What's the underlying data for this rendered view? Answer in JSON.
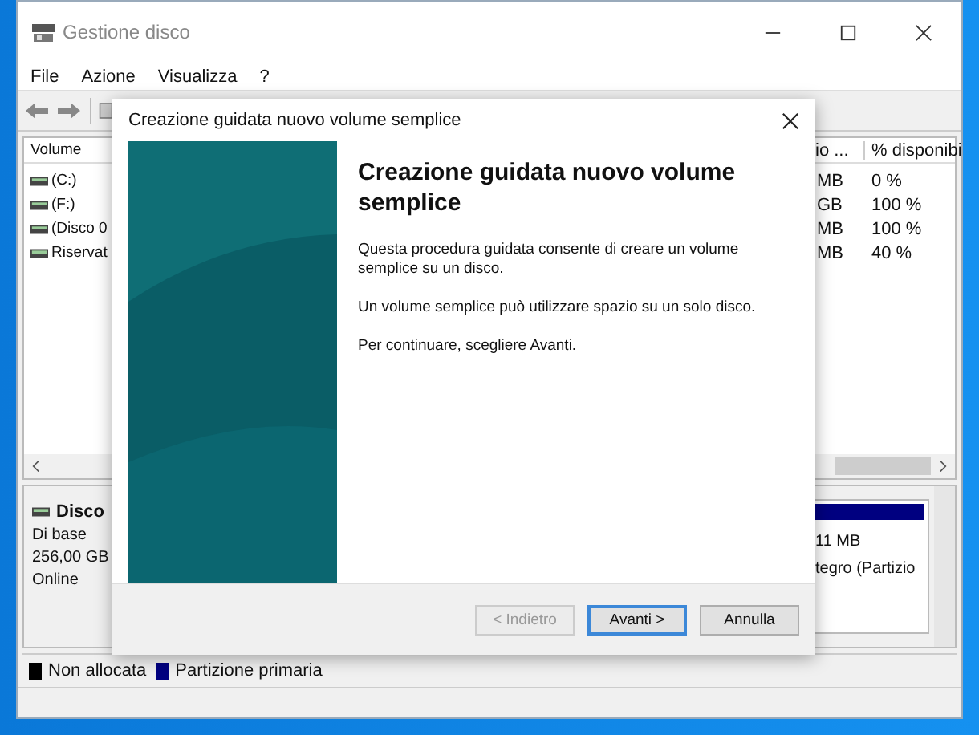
{
  "window": {
    "title": "Gestione disco"
  },
  "menu": [
    "File",
    "Azione",
    "Visualizza",
    "?"
  ],
  "table": {
    "columns": [
      "Volume",
      "io ...",
      "% disponibi"
    ],
    "rows": [
      [
        "(C:)",
        "MB",
        "0 %"
      ],
      [
        "(F:)",
        "GB",
        "100 %"
      ],
      [
        "(Disco 0",
        "MB",
        "100 %"
      ],
      [
        "Riservat",
        "MB",
        "40 %"
      ]
    ]
  },
  "disk": {
    "name": "Disco",
    "type": "Di base",
    "size": "256,00 GB",
    "status": "Online"
  },
  "partition": {
    "size": "11 MB",
    "status": "tegro (Partizio"
  },
  "legend": [
    {
      "label": "Non allocata",
      "color": "#000000"
    },
    {
      "label": "Partizione primaria",
      "color": "#000080"
    }
  ],
  "dialog": {
    "title": "Creazione guidata nuovo volume semplice",
    "heading": "Creazione guidata nuovo volume semplice",
    "paragraphs": [
      "Questa procedura guidata consente di creare un volume semplice su un disco.",
      "Un volume semplice può utilizzare spazio su un solo disco.",
      "Per continuare, scegliere Avanti."
    ],
    "buttons": [
      {
        "label": "< Indietro",
        "disabled": true,
        "selected": false
      },
      {
        "label": "Avanti >",
        "disabled": false,
        "selected": true
      },
      {
        "label": "Annulla",
        "disabled": false,
        "selected": false
      }
    ]
  }
}
